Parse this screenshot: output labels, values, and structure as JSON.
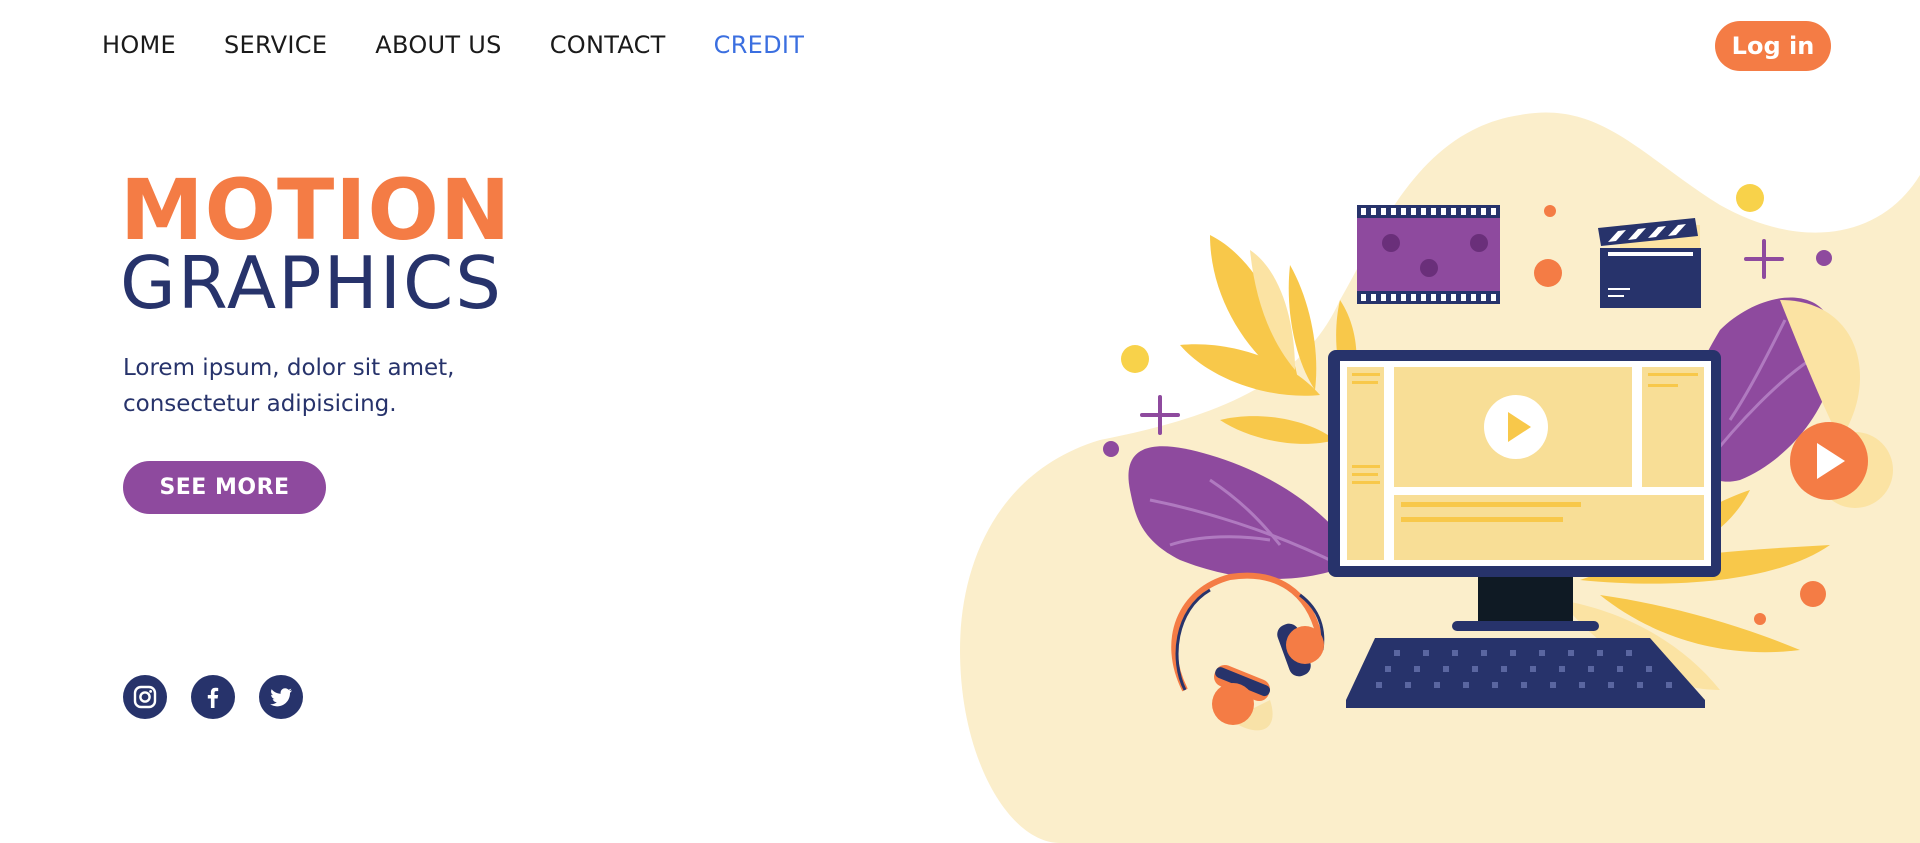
{
  "nav": {
    "items": [
      {
        "label": "HOME"
      },
      {
        "label": "SERVICE"
      },
      {
        "label": "ABOUT US"
      },
      {
        "label": "CONTACT"
      },
      {
        "label": "CREDIT",
        "active": true
      }
    ],
    "login_label": "Log in"
  },
  "hero": {
    "title_line1": "MOTION",
    "title_line2": "GRAPHICS",
    "description": "Lorem ipsum, dolor sit amet, consectetur adipisicing.",
    "cta_label": "SEE MORE"
  },
  "social": [
    {
      "icon": "instagram-icon"
    },
    {
      "icon": "facebook-icon"
    },
    {
      "icon": "twitter-icon"
    }
  ],
  "colors": {
    "accent_orange": "#f47c45",
    "navy": "#27336b",
    "purple": "#8e4a9e",
    "link_active": "#3b6fe0",
    "blob_cream": "#fbeecb",
    "yellow": "#f8c84a"
  }
}
